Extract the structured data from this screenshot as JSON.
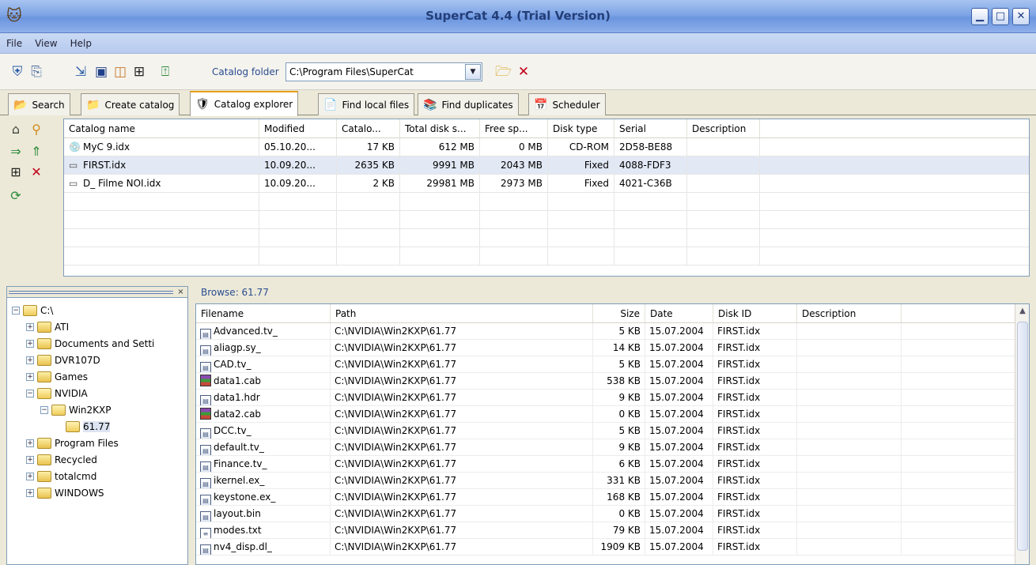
{
  "window": {
    "title": "SuperCat 4.4 (Trial Version)",
    "min_glyph": "▁",
    "max_glyph": "□",
    "close_glyph": "✕"
  },
  "menu": [
    "File",
    "View",
    "Help"
  ],
  "toolbar": {
    "catalog_folder_label": "Catalog folder",
    "catalog_folder_value": "C:\\Program Files\\SuperCat",
    "dropdown_glyph": "▼"
  },
  "tabs": [
    {
      "label": "Search",
      "icon": "folder-search-icon",
      "glyph": "📂",
      "active": false
    },
    {
      "label": "Create catalog",
      "icon": "create-catalog-icon",
      "glyph": "📁",
      "active": false
    },
    {
      "label": "Catalog explorer",
      "icon": "catalog-explorer-icon",
      "glyph": "🛡",
      "active": true
    },
    {
      "label": "Find local files",
      "icon": "find-local-files-icon",
      "glyph": "📄",
      "active": false
    },
    {
      "label": "Find duplicates",
      "icon": "find-duplicates-icon",
      "glyph": "📚",
      "active": false
    },
    {
      "label": "Scheduler",
      "icon": "scheduler-icon",
      "glyph": "📅",
      "active": false
    }
  ],
  "catalog_grid": {
    "columns": [
      "Catalog name",
      "Modified",
      "Catalo...",
      "Total disk s...",
      "Free sp...",
      "Disk type",
      "Serial",
      "Description"
    ],
    "rows": [
      {
        "name": "MyC 9.idx",
        "modified": "05.10.20...",
        "catalog_size": "17 KB",
        "total": "612 MB",
        "free": "0 MB",
        "disk_type": "CD-ROM",
        "serial": "2D58-BE88",
        "description": "",
        "icon": "cdrom-icon",
        "selected": false
      },
      {
        "name": "FIRST.idx",
        "modified": "10.09.20...",
        "catalog_size": "2635 KB",
        "total": "9991 MB",
        "free": "2043 MB",
        "disk_type": "Fixed",
        "serial": "4088-FDF3",
        "description": "",
        "icon": "harddisk-icon",
        "selected": true
      },
      {
        "name": "D_  Filme NOI.idx",
        "modified": "10.09.20...",
        "catalog_size": "2 KB",
        "total": "29981 MB",
        "free": "2973 MB",
        "disk_type": "Fixed",
        "serial": "4021-C36B",
        "description": "",
        "icon": "harddisk-icon",
        "selected": false
      }
    ]
  },
  "tree": {
    "close_glyph": "×",
    "nodes": [
      {
        "label": "C:\\",
        "depth": 0,
        "expander": "⊟",
        "open": true,
        "selected": false
      },
      {
        "label": "ATI",
        "depth": 1,
        "expander": "⊞",
        "open": false,
        "selected": false
      },
      {
        "label": "Documents and Setti",
        "depth": 1,
        "expander": "⊞",
        "open": false,
        "selected": false
      },
      {
        "label": "DVR107D",
        "depth": 1,
        "expander": "⊞",
        "open": false,
        "selected": false
      },
      {
        "label": "Games",
        "depth": 1,
        "expander": "⊞",
        "open": false,
        "selected": false
      },
      {
        "label": "NVIDIA",
        "depth": 1,
        "expander": "⊟",
        "open": true,
        "selected": false
      },
      {
        "label": "Win2KXP",
        "depth": 2,
        "expander": "⊟",
        "open": true,
        "selected": false
      },
      {
        "label": "61.77",
        "depth": 3,
        "expander": "",
        "open": true,
        "selected": true
      },
      {
        "label": "Program Files",
        "depth": 1,
        "expander": "⊞",
        "open": false,
        "selected": false
      },
      {
        "label": "Recycled",
        "depth": 1,
        "expander": "⊞",
        "open": false,
        "selected": false
      },
      {
        "label": "totalcmd",
        "depth": 1,
        "expander": "⊞",
        "open": false,
        "selected": false
      },
      {
        "label": "WINDOWS",
        "depth": 1,
        "expander": "⊞",
        "open": false,
        "selected": false
      }
    ]
  },
  "browse": {
    "label": "Browse: 61.77",
    "columns": [
      "Filename",
      "Path",
      "Size",
      "Date",
      "Disk ID",
      "Description"
    ],
    "rows": [
      {
        "filename": "Advanced.tv_",
        "path": "C:\\NVIDIA\\Win2KXP\\61.77",
        "size": "5 KB",
        "date": "15.07.2004",
        "disk": "FIRST.idx",
        "kind": "file"
      },
      {
        "filename": "aliagp.sy_",
        "path": "C:\\NVIDIA\\Win2KXP\\61.77",
        "size": "14 KB",
        "date": "15.07.2004",
        "disk": "FIRST.idx",
        "kind": "file"
      },
      {
        "filename": "CAD.tv_",
        "path": "C:\\NVIDIA\\Win2KXP\\61.77",
        "size": "5 KB",
        "date": "15.07.2004",
        "disk": "FIRST.idx",
        "kind": "file"
      },
      {
        "filename": "data1.cab",
        "path": "C:\\NVIDIA\\Win2KXP\\61.77",
        "size": "538 KB",
        "date": "15.07.2004",
        "disk": "FIRST.idx",
        "kind": "cab"
      },
      {
        "filename": "data1.hdr",
        "path": "C:\\NVIDIA\\Win2KXP\\61.77",
        "size": "9 KB",
        "date": "15.07.2004",
        "disk": "FIRST.idx",
        "kind": "file"
      },
      {
        "filename": "data2.cab",
        "path": "C:\\NVIDIA\\Win2KXP\\61.77",
        "size": "0 KB",
        "date": "15.07.2004",
        "disk": "FIRST.idx",
        "kind": "cab"
      },
      {
        "filename": "DCC.tv_",
        "path": "C:\\NVIDIA\\Win2KXP\\61.77",
        "size": "5 KB",
        "date": "15.07.2004",
        "disk": "FIRST.idx",
        "kind": "file"
      },
      {
        "filename": "default.tv_",
        "path": "C:\\NVIDIA\\Win2KXP\\61.77",
        "size": "9 KB",
        "date": "15.07.2004",
        "disk": "FIRST.idx",
        "kind": "file"
      },
      {
        "filename": "Finance.tv_",
        "path": "C:\\NVIDIA\\Win2KXP\\61.77",
        "size": "6 KB",
        "date": "15.07.2004",
        "disk": "FIRST.idx",
        "kind": "file"
      },
      {
        "filename": "ikernel.ex_",
        "path": "C:\\NVIDIA\\Win2KXP\\61.77",
        "size": "331 KB",
        "date": "15.07.2004",
        "disk": "FIRST.idx",
        "kind": "file"
      },
      {
        "filename": "keystone.ex_",
        "path": "C:\\NVIDIA\\Win2KXP\\61.77",
        "size": "168 KB",
        "date": "15.07.2004",
        "disk": "FIRST.idx",
        "kind": "file"
      },
      {
        "filename": "layout.bin",
        "path": "C:\\NVIDIA\\Win2KXP\\61.77",
        "size": "0 KB",
        "date": "15.07.2004",
        "disk": "FIRST.idx",
        "kind": "file"
      },
      {
        "filename": "modes.txt",
        "path": "C:\\NVIDIA\\Win2KXP\\61.77",
        "size": "79 KB",
        "date": "15.07.2004",
        "disk": "FIRST.idx",
        "kind": "txt"
      },
      {
        "filename": "nv4_disp.dl_",
        "path": "C:\\NVIDIA\\Win2KXP\\61.77",
        "size": "1909 KB",
        "date": "15.07.2004",
        "disk": "FIRST.idx",
        "kind": "file"
      }
    ]
  },
  "icons": {
    "app": "cat-app-icon",
    "toolbar": [
      "new-catalog-icon",
      "copy-icon",
      "import-icon",
      "scan-icon",
      "properties-icon",
      "tree-icon",
      "export-icon"
    ],
    "side": [
      "catalog-properties-icon",
      "find-catalog-icon",
      "update-icon",
      "move-up-icon",
      "tree-structure-icon",
      "delete-catalog-icon",
      "refresh-icon"
    ],
    "open_folder": "open-folder-icon",
    "delete": "delete-icon"
  },
  "colors": {
    "title_text": "#233e78",
    "selection": "#e2e8f4",
    "active_tab_accent": "#e6a019",
    "delete_red": "#c0001a"
  }
}
